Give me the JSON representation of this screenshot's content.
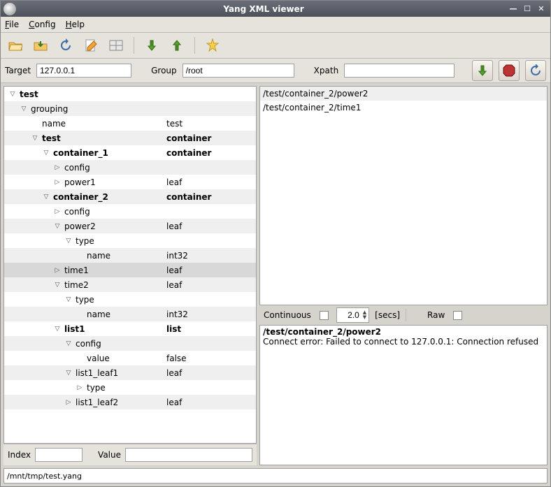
{
  "window": {
    "title": "Yang XML viewer"
  },
  "menu": {
    "file": "File",
    "config": "Config",
    "help": "Help"
  },
  "params": {
    "target_label": "Target",
    "target_value": "127.0.0.1",
    "group_label": "Group",
    "group_value": "/root",
    "xpath_label": "Xpath",
    "xpath_value": ""
  },
  "tree": [
    {
      "d": 0,
      "t": "open",
      "n": "test",
      "v": "",
      "b": true
    },
    {
      "d": 1,
      "t": "open",
      "n": "grouping",
      "v": ""
    },
    {
      "d": 2,
      "t": "none",
      "n": "name",
      "v": "test"
    },
    {
      "d": 2,
      "t": "open",
      "n": "test",
      "v": "container",
      "b": true
    },
    {
      "d": 3,
      "t": "open",
      "n": "container_1",
      "v": "container",
      "b": true
    },
    {
      "d": 4,
      "t": "closed",
      "n": "config",
      "v": ""
    },
    {
      "d": 4,
      "t": "closed",
      "n": "power1",
      "v": "leaf"
    },
    {
      "d": 3,
      "t": "open",
      "n": "container_2",
      "v": "container",
      "b": true
    },
    {
      "d": 4,
      "t": "closed",
      "n": "config",
      "v": ""
    },
    {
      "d": 4,
      "t": "open",
      "n": "power2",
      "v": "leaf"
    },
    {
      "d": 5,
      "t": "open",
      "n": "type",
      "v": ""
    },
    {
      "d": 6,
      "t": "none",
      "n": "name",
      "v": "int32"
    },
    {
      "d": 4,
      "t": "closed",
      "n": "time1",
      "v": "leaf",
      "sel": true
    },
    {
      "d": 4,
      "t": "open",
      "n": "time2",
      "v": "leaf"
    },
    {
      "d": 5,
      "t": "open",
      "n": "type",
      "v": ""
    },
    {
      "d": 6,
      "t": "none",
      "n": "name",
      "v": "int32"
    },
    {
      "d": 4,
      "t": "open",
      "n": "list1",
      "v": "list",
      "b": true
    },
    {
      "d": 5,
      "t": "open",
      "n": "config",
      "v": ""
    },
    {
      "d": 6,
      "t": "none",
      "n": "value",
      "v": "false"
    },
    {
      "d": 5,
      "t": "open",
      "n": "list1_leaf1",
      "v": "leaf"
    },
    {
      "d": 6,
      "t": "closed",
      "n": "type",
      "v": ""
    },
    {
      "d": 5,
      "t": "closed",
      "n": "list1_leaf2",
      "v": "leaf"
    }
  ],
  "idx": {
    "index_label": "Index",
    "index_value": "",
    "value_label": "Value",
    "value_value": ""
  },
  "xpaths": [
    "/test/container_2/power2",
    "/test/container_2/time1"
  ],
  "cont": {
    "label": "Continuous",
    "value": "2.0",
    "unit": "[secs]",
    "raw_label": "Raw"
  },
  "log": {
    "title": "/test/container_2/power2",
    "msg": "Connect error: Failed to connect to 127.0.0.1: Connection refused"
  },
  "status": {
    "path": "/mnt/tmp/test.yang"
  }
}
